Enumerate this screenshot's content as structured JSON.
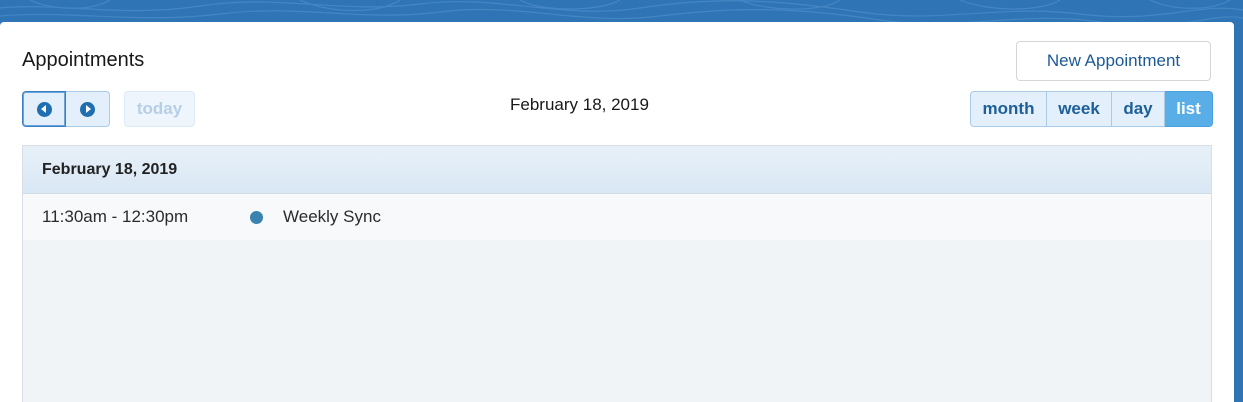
{
  "card": {
    "title": "Appointments",
    "new_button_label": "New Appointment"
  },
  "toolbar": {
    "prev_icon": "chevron-left-circle-icon",
    "next_icon": "chevron-right-circle-icon",
    "today_label": "today",
    "current_date": "February 18, 2019",
    "views": [
      "month",
      "week",
      "day",
      "list"
    ],
    "active_view": "list"
  },
  "list": {
    "day_header": "February 18, 2019",
    "events": [
      {
        "time": "11:30am - 12:30pm",
        "title": "Weekly Sync",
        "color": "#3a83b0"
      }
    ]
  },
  "colors": {
    "accent": "#5aaee8",
    "header_background": "#2f74b5"
  }
}
